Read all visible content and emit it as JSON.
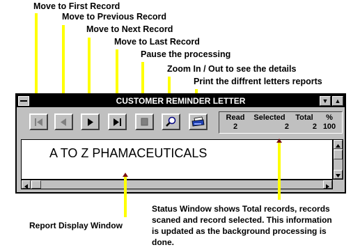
{
  "annotations": {
    "first": "Move to First Record",
    "previous": "Move to Previous Record",
    "next": "Move to Next Record",
    "last": "Move to Last Record",
    "pause": "Pause the processing",
    "zoom": "Zoom In / Out to see the details",
    "print": "Print the diffrent letters reports",
    "status_line1": "Status Window shows Total records, records",
    "status_line2": "scaned and record selected. This information",
    "status_line3": "is updated as the background processing is",
    "status_line4": "done.",
    "report_window": "Report Display Window"
  },
  "window": {
    "title": "CUSTOMER REMINDER LETTER"
  },
  "status": {
    "read_label": "Read",
    "read_value": "2",
    "selected_label": "Selected",
    "selected_value": "2",
    "total_label": "Total",
    "total_value": "2",
    "percent_label": "%",
    "percent_value": "100"
  },
  "report": {
    "heading": "A TO Z PHAMACEUTICALS"
  },
  "colors": {
    "callout_line": "#ffff00",
    "arrow": "#7a1010",
    "window_face": "#c0c0c0",
    "titlebar": "#000000"
  },
  "icons": {
    "first": "skip-first-icon",
    "previous": "previous-icon",
    "next": "next-icon",
    "last": "skip-last-icon",
    "pause": "stop-icon",
    "zoom": "magnifier-icon",
    "print": "printer-icon"
  }
}
